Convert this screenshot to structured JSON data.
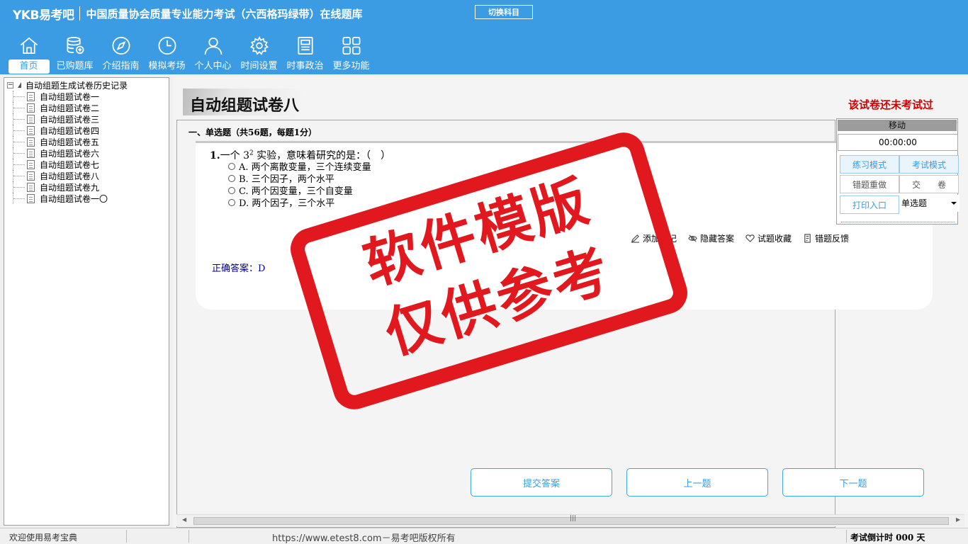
{
  "header": {
    "logo": "YKB易考吧",
    "title": "中国质量协会质量专业能力考试（六西格玛绿带）在线题库",
    "switch_subject": "切换科目"
  },
  "nav": [
    {
      "label": "首页",
      "icon": "home-icon"
    },
    {
      "label": "已购题库",
      "icon": "database-icon"
    },
    {
      "label": "介绍指南",
      "icon": "compass-icon"
    },
    {
      "label": "模拟考场",
      "icon": "clock-icon"
    },
    {
      "label": "个人中心",
      "icon": "user-icon"
    },
    {
      "label": "时间设置",
      "icon": "gear-icon"
    },
    {
      "label": "时事政治",
      "icon": "news-icon"
    },
    {
      "label": "更多功能",
      "icon": "grid-icon"
    }
  ],
  "tree": {
    "root": "自动组题生成试卷历史记录",
    "items": [
      "自动组题试卷一",
      "自动组题试卷二",
      "自动组题试卷三",
      "自动组题试卷四",
      "自动组题试卷五",
      "自动组题试卷六",
      "自动组题试卷七",
      "自动组题试卷八",
      "自动组题试卷九",
      "自动组题试卷一〇"
    ]
  },
  "paper": {
    "title": "自动组题试卷八",
    "status": "该试卷还未考试过",
    "section": "一、单选题（共56题，每题1分）"
  },
  "question": {
    "number": "1.",
    "text_before": "一个 3",
    "superscript": "2",
    "text_after": " 实验，意味着研究的是：（　）",
    "options": [
      "A. 两个离散变量，三个连续变量",
      "B. 三个因子，两个水平",
      "C. 两个因变量，三个自变量",
      "D. 两个因子，三个水平"
    ],
    "answer": "正确答案：D"
  },
  "tools": [
    {
      "label": "添加笔记",
      "icon": "pencil-icon"
    },
    {
      "label": "隐藏答案",
      "icon": "eye-icon"
    },
    {
      "label": "试题收藏",
      "icon": "heart-icon"
    },
    {
      "label": "错题反馈",
      "icon": "feedback-icon"
    }
  ],
  "buttons": {
    "submit": "提交答案",
    "prev": "上一题",
    "next": "下一题"
  },
  "side": {
    "move": "移动",
    "timer": "00:00:00",
    "practice": "练习模式",
    "exam": "考试模式",
    "redo": "错题重做",
    "hand_in": "交　　卷",
    "print": "打印入口",
    "type_select": "单选题"
  },
  "watermark": {
    "line1": "软件模版",
    "line2": "仅供参考"
  },
  "status": {
    "welcome": "欢迎使用易考宝典",
    "copyright": "https://www.etest8.com－易考吧版权所有",
    "countdown": "考试倒计时 000 天"
  },
  "colors": {
    "brand": "#3b9be3",
    "stamp": "#e1191f",
    "warning": "#d00000",
    "answer": "#00008b"
  }
}
